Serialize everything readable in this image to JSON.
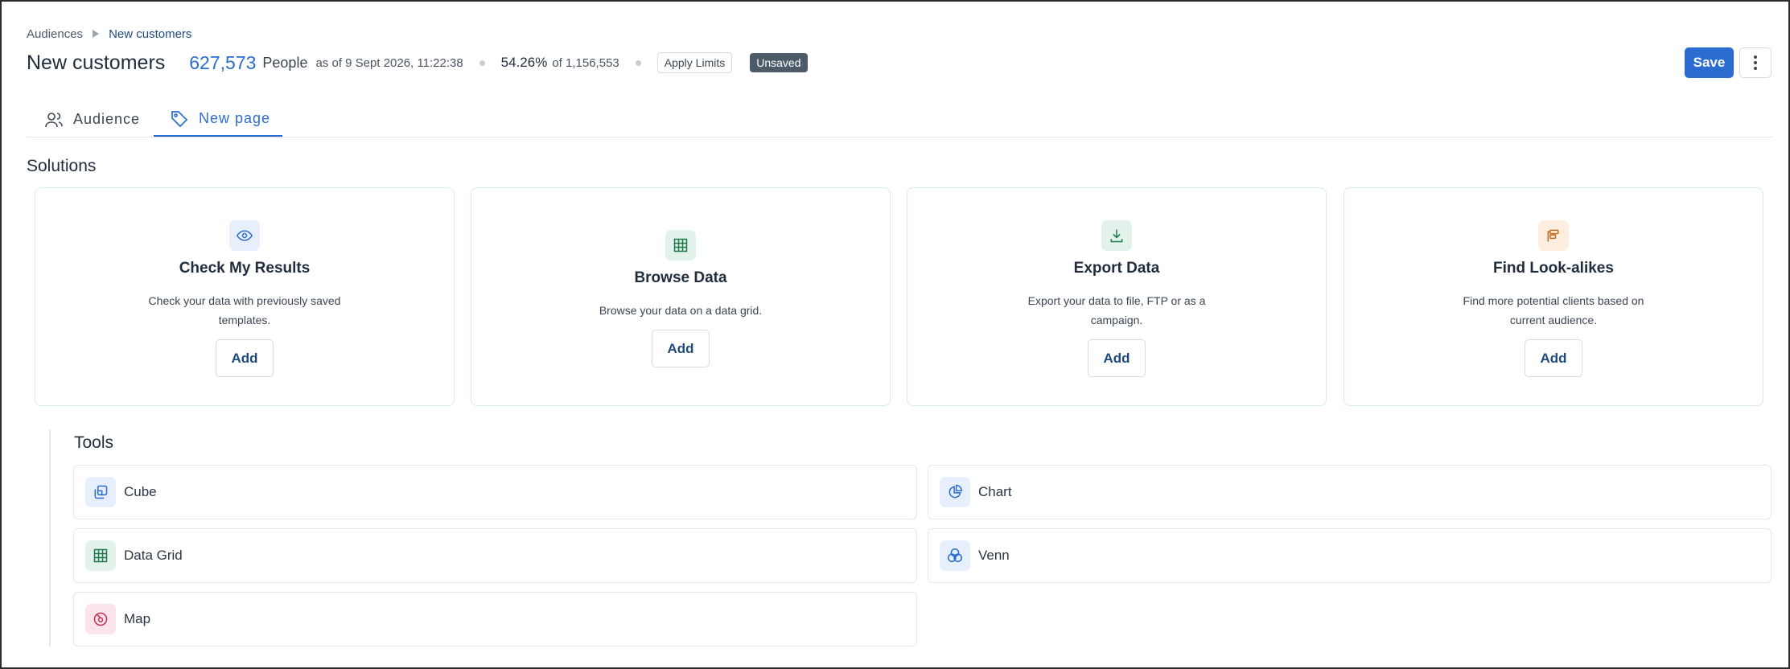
{
  "breadcrumb": {
    "root": "Audiences",
    "current": "New customers"
  },
  "header": {
    "title": "New customers",
    "people_count": "627,573",
    "people_label": "People",
    "as_of": "as of 9 Sept 2026, 11:22:38",
    "percent": "54.26%",
    "percent_of": "of 1,156,553",
    "apply_limits": "Apply Limits",
    "status_badge": "Unsaved",
    "save_label": "Save"
  },
  "tabs": [
    {
      "label": "Audience",
      "icon": "users-icon",
      "active": false
    },
    {
      "label": "New page",
      "icon": "tag-icon",
      "active": true
    }
  ],
  "solutions": {
    "title": "Solutions",
    "cards": [
      {
        "title": "Check My Results",
        "description": "Check your data with previously saved templates.",
        "button": "Add",
        "icon": "eye-icon",
        "icon_bg": "#e6effb",
        "icon_color": "#2b6cd1"
      },
      {
        "title": "Browse Data",
        "description": "Browse your data on a data grid.",
        "button": "Add",
        "icon": "grid-icon",
        "icon_bg": "#e3f2ea",
        "icon_color": "#1e7a4c"
      },
      {
        "title": "Export Data",
        "description": "Export your data to file, FTP or as a campaign.",
        "button": "Add",
        "icon": "download-icon",
        "icon_bg": "#e3f2ea",
        "icon_color": "#1e7a4c"
      },
      {
        "title": "Find Look-alikes",
        "description": "Find more potential clients based on current audience.",
        "button": "Add",
        "icon": "lookalike-icon",
        "icon_bg": "#fdeee0",
        "icon_color": "#c26b1e"
      }
    ]
  },
  "tools": {
    "title": "Tools",
    "items": [
      {
        "label": "Cube",
        "icon": "cube-icon",
        "icon_bg": "#e6effb",
        "icon_color": "#2b6cd1"
      },
      {
        "label": "Chart",
        "icon": "pie-chart-icon",
        "icon_bg": "#e6effb",
        "icon_color": "#2b6cd1"
      },
      {
        "label": "Data Grid",
        "icon": "grid-icon",
        "icon_bg": "#e3f2ea",
        "icon_color": "#1e7a4c"
      },
      {
        "label": "Venn",
        "icon": "venn-icon",
        "icon_bg": "#e6effb",
        "icon_color": "#2b6cd1"
      },
      {
        "label": "Map",
        "icon": "map-icon",
        "icon_bg": "#fbe4ea",
        "icon_color": "#c2305a"
      }
    ]
  }
}
